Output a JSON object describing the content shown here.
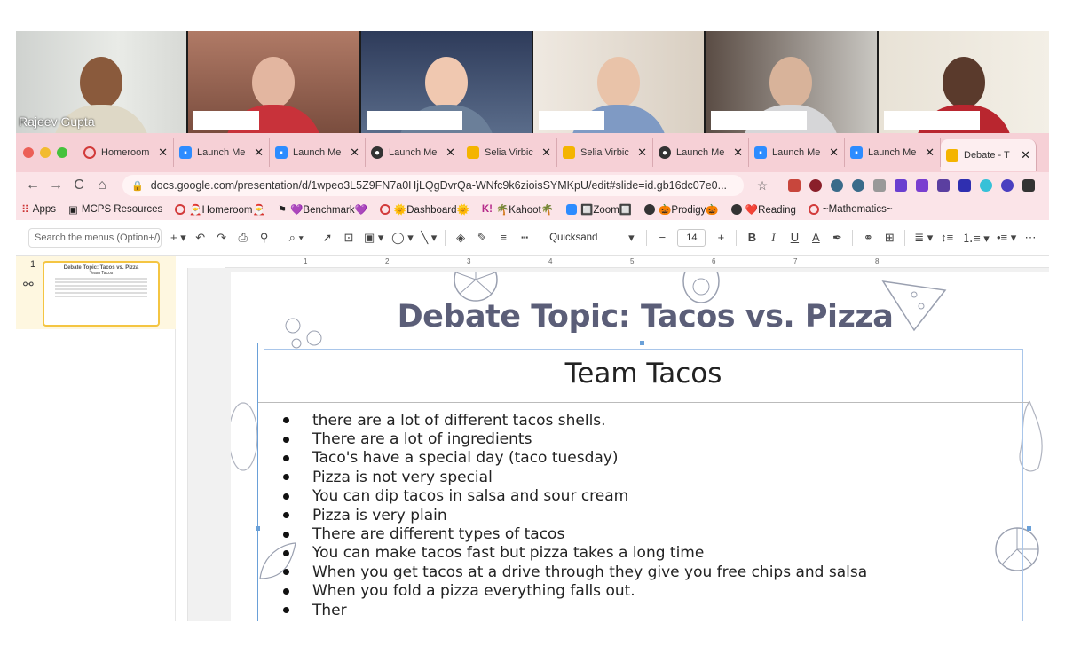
{
  "video": {
    "participants": [
      {
        "name": "Rajeev Gupta"
      },
      {
        "name": ""
      },
      {
        "name": ""
      },
      {
        "name": ""
      },
      {
        "name": ""
      },
      {
        "name": ""
      }
    ]
  },
  "tabs": [
    {
      "label": "Homeroom",
      "icon": "circle-icon"
    },
    {
      "label": "Launch Me",
      "icon": "zoom-icon"
    },
    {
      "label": "Launch Me",
      "icon": "zoom-icon"
    },
    {
      "label": "Launch Me",
      "icon": "globe-icon"
    },
    {
      "label": "Selia Virbic",
      "icon": "slides-icon"
    },
    {
      "label": "Selia Virbic",
      "icon": "slides-icon"
    },
    {
      "label": "Launch Me",
      "icon": "globe-icon"
    },
    {
      "label": "Launch Me",
      "icon": "zoom-icon"
    },
    {
      "label": "Launch Me",
      "icon": "zoom-icon"
    },
    {
      "label": "Debate - T",
      "icon": "slides-icon"
    }
  ],
  "address": {
    "url": "docs.google.com/presentation/d/1wpeo3L5Z9FN7a0HjLQgDvrQa-WNfc9k6zioisSYMKpU/edit#slide=id.gb16dc07e0..."
  },
  "bookmarks": [
    {
      "label": "Apps"
    },
    {
      "label": "MCPS Resources"
    },
    {
      "label": "🎅Homeroom🎅"
    },
    {
      "label": "💜Benchmark💜"
    },
    {
      "label": "🌞Dashboard🌞"
    },
    {
      "label": "🌴Kahoot🌴"
    },
    {
      "label": "🔲Zoom🔲"
    },
    {
      "label": "🎃Prodigy🎃"
    },
    {
      "label": "❤️Reading"
    },
    {
      "label": "~Mathematics~"
    }
  ],
  "toolbar": {
    "search_placeholder": "Search the menus (Option+/)",
    "font": "Quicksand",
    "font_size": "14"
  },
  "filmstrip": {
    "slide_number": "1",
    "thumb_title": "Debate Topic: Tacos vs. Pizza",
    "thumb_subtitle": "Team Tacos"
  },
  "ruler": {
    "ticks": [
      "1",
      "2",
      "3",
      "4",
      "5",
      "6",
      "7",
      "8"
    ]
  },
  "slide": {
    "title": "Debate Topic: Tacos vs. Pizza",
    "team_title": "Team Tacos",
    "bullets": [
      "there are a lot of different tacos shells.",
      "There are a lot of ingredients",
      "Taco's have a special day (taco tuesday)",
      "Pizza is not very special",
      "You can dip tacos in salsa and sour cream",
      "Pizza is very plain",
      "There are different types of tacos",
      "You can make tacos fast but pizza takes a long time",
      "When you get tacos at a drive through they give you free chips and salsa",
      "When you fold a pizza everything falls out.",
      "Ther"
    ]
  },
  "colors": {
    "tab_bar": "#f6d0d6",
    "title": "#5b5e78",
    "selection": "#6aa0d8",
    "active_speaker": "#9cd64a"
  }
}
